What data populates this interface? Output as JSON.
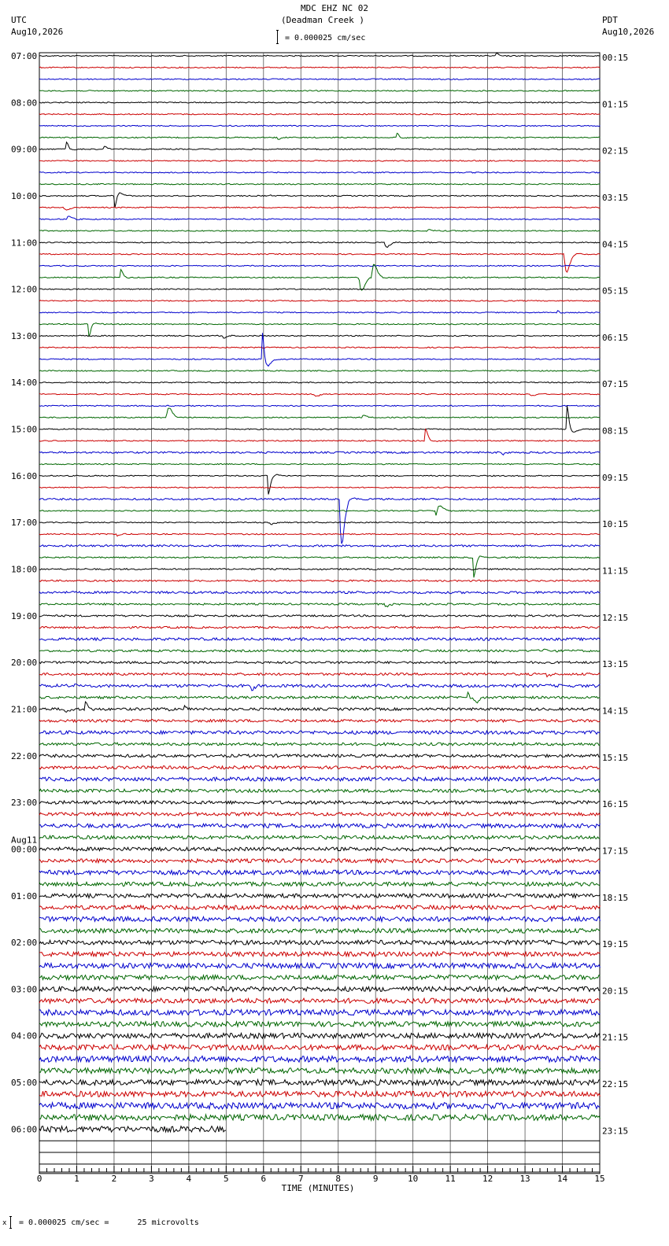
{
  "header": {
    "title": "MDC EHZ NC 02",
    "subtitle": "(Deadman Creek )",
    "scale_text": "= 0.000025 cm/sec",
    "left_tz": "UTC",
    "left_date": "Aug10,2026",
    "right_tz": "PDT",
    "right_date": "Aug10,2026"
  },
  "footer": {
    "scale_text": "= 0.000025 cm/sec =      25 microvolts"
  },
  "colors": {
    "trace_cycle": [
      "#000000",
      "#cc0000",
      "#0000cc",
      "#006600"
    ],
    "grid": "#000000",
    "background": "#ffffff"
  },
  "chart_data": {
    "type": "line",
    "title": "MDC EHZ NC 02",
    "xlabel": "TIME (MINUTES)",
    "ylabel": "",
    "xlim": [
      0,
      15
    ],
    "x_ticks": [
      "0",
      "1",
      "2",
      "3",
      "4",
      "5",
      "6",
      "7",
      "8",
      "9",
      "10",
      "11",
      "12",
      "13",
      "14",
      "15"
    ],
    "grid": true,
    "rows_total": 96,
    "rows_with_data": 93,
    "last_row_end_minute": 5,
    "left_hour_labels": [
      {
        "label": "07:00",
        "row": 0
      },
      {
        "label": "08:00",
        "row": 4
      },
      {
        "label": "09:00",
        "row": 8
      },
      {
        "label": "10:00",
        "row": 12
      },
      {
        "label": "11:00",
        "row": 16
      },
      {
        "label": "12:00",
        "row": 20
      },
      {
        "label": "13:00",
        "row": 24
      },
      {
        "label": "14:00",
        "row": 28
      },
      {
        "label": "15:00",
        "row": 32
      },
      {
        "label": "16:00",
        "row": 36
      },
      {
        "label": "17:00",
        "row": 40
      },
      {
        "label": "18:00",
        "row": 44
      },
      {
        "label": "19:00",
        "row": 48
      },
      {
        "label": "20:00",
        "row": 52
      },
      {
        "label": "21:00",
        "row": 56
      },
      {
        "label": "22:00",
        "row": 60
      },
      {
        "label": "23:00",
        "row": 64
      },
      {
        "label": "00:00",
        "row": 68,
        "date": "Aug11"
      },
      {
        "label": "01:00",
        "row": 72
      },
      {
        "label": "02:00",
        "row": 76
      },
      {
        "label": "03:00",
        "row": 80
      },
      {
        "label": "04:00",
        "row": 84
      },
      {
        "label": "05:00",
        "row": 88
      },
      {
        "label": "06:00",
        "row": 92
      }
    ],
    "right_hour_labels": [
      "00:15",
      "01:15",
      "02:15",
      "03:15",
      "04:15",
      "05:15",
      "06:15",
      "07:15",
      "08:15",
      "09:15",
      "10:15",
      "11:15",
      "12:15",
      "13:15",
      "14:15",
      "15:15",
      "16:15",
      "17:15",
      "18:15",
      "19:15",
      "20:15",
      "21:15",
      "22:15",
      "23:15"
    ],
    "events": [
      {
        "row": 0,
        "minute": 12.25,
        "amp": 6
      },
      {
        "row": 7,
        "minute": 9.6,
        "amp": 12
      },
      {
        "row": 7,
        "minute": 6.4,
        "amp": 4
      },
      {
        "row": 8,
        "minute": 0.75,
        "amp": 18
      },
      {
        "row": 8,
        "minute": 1.75,
        "amp": 6
      },
      {
        "row": 12,
        "minute": 2.05,
        "amp": 40
      },
      {
        "row": 12,
        "minute": 6.1,
        "amp": 4
      },
      {
        "row": 13,
        "minute": 0.7,
        "amp": 10
      },
      {
        "row": 14,
        "minute": 0.8,
        "amp": 8
      },
      {
        "row": 15,
        "minute": 10.4,
        "amp": 6
      },
      {
        "row": 16,
        "minute": 9.3,
        "amp": 14
      },
      {
        "row": 19,
        "minute": 2.2,
        "amp": 18
      },
      {
        "row": 19,
        "minute": 8.6,
        "amp": 60
      },
      {
        "row": 19,
        "minute": 8.95,
        "amp": 45
      },
      {
        "row": 22,
        "minute": 13.9,
        "amp": 6
      },
      {
        "row": 23,
        "minute": 1.35,
        "amp": 30
      },
      {
        "row": 24,
        "minute": 4.95,
        "amp": 6
      },
      {
        "row": 29,
        "minute": 7.4,
        "amp": 8
      },
      {
        "row": 29,
        "minute": 13.15,
        "amp": 8
      },
      {
        "row": 31,
        "minute": 8.7,
        "amp": 6
      },
      {
        "row": 31,
        "minute": 3.45,
        "amp": 40
      },
      {
        "row": 32,
        "minute": 14.15,
        "amp": 60
      },
      {
        "row": 33,
        "minute": 10.35,
        "amp": 25
      },
      {
        "row": 34,
        "minute": 12.4,
        "amp": 5
      },
      {
        "row": 35,
        "minute": 14.6,
        "amp": 5
      },
      {
        "row": 26,
        "minute": 6.0,
        "amp": 90
      },
      {
        "row": 36,
        "minute": 6.15,
        "amp": 40
      },
      {
        "row": 38,
        "minute": 8.1,
        "amp": 120
      },
      {
        "row": 39,
        "minute": 10.65,
        "amp": 40
      },
      {
        "row": 40,
        "minute": 6.2,
        "amp": 6
      },
      {
        "row": 41,
        "minute": 2.1,
        "amp": 4
      },
      {
        "row": 43,
        "minute": 11.65,
        "amp": 45
      },
      {
        "row": 47,
        "minute": 9.3,
        "amp": 6
      },
      {
        "row": 51,
        "minute": 13.5,
        "amp": 6
      },
      {
        "row": 53,
        "minute": 13.6,
        "amp": 5
      },
      {
        "row": 54,
        "minute": 5.7,
        "amp": 8
      },
      {
        "row": 54,
        "minute": 0.85,
        "amp": 6
      },
      {
        "row": 55,
        "minute": 11.5,
        "amp": 18
      },
      {
        "row": 55,
        "minute": 11.7,
        "amp": 14
      },
      {
        "row": 56,
        "minute": 0.7,
        "amp": 12
      },
      {
        "row": 56,
        "minute": 1.25,
        "amp": 14
      },
      {
        "row": 56,
        "minute": 3.5,
        "amp": 6
      },
      {
        "row": 56,
        "minute": 3.9,
        "amp": 6
      },
      {
        "row": 17,
        "minute": 14.1,
        "amp": 70
      }
    ]
  }
}
